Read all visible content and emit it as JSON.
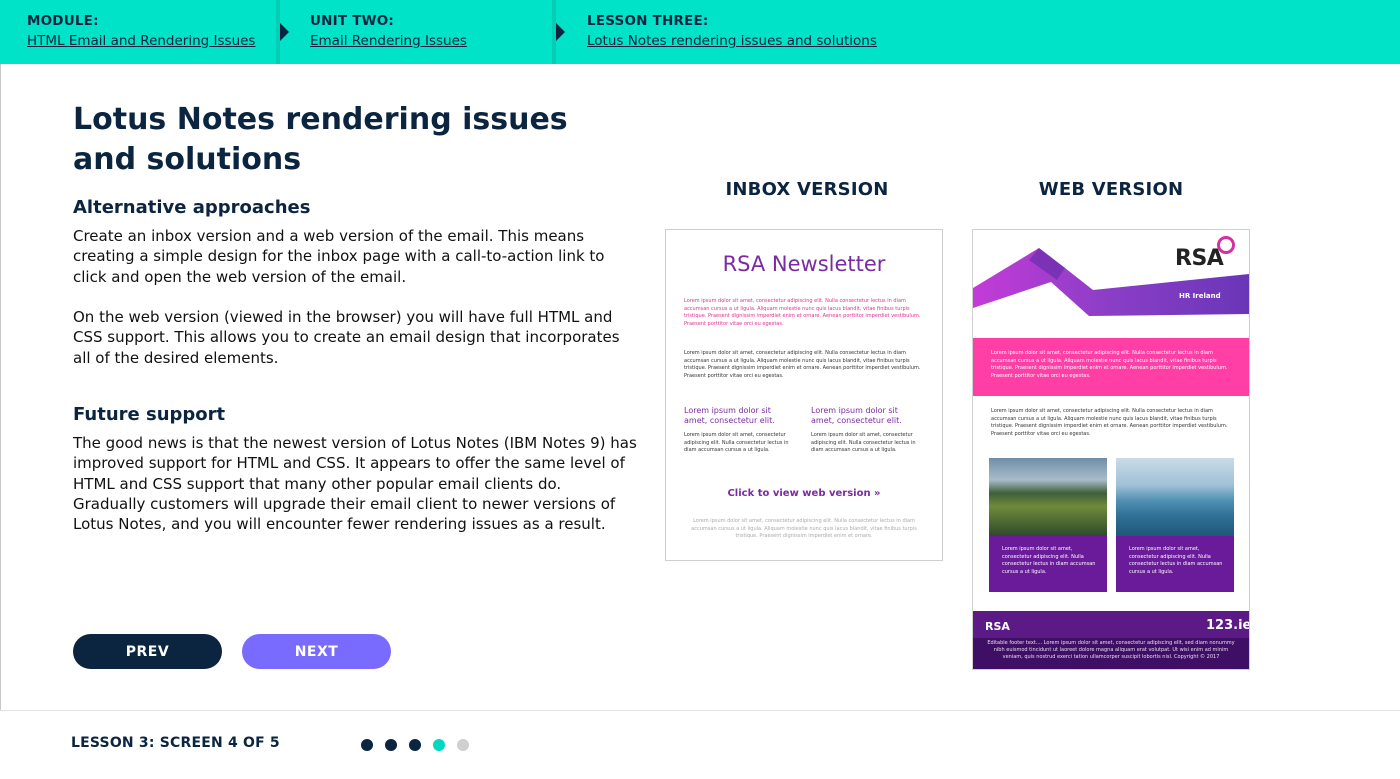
{
  "breadcrumb": {
    "module": {
      "label": "MODULE:",
      "link": "HTML Email and Rendering Issues"
    },
    "unit": {
      "label": "UNIT TWO:",
      "link": "Email Rendering Issues"
    },
    "lesson": {
      "label": "LESSON THREE:",
      "link": "Lotus Notes rendering issues and solutions"
    }
  },
  "content": {
    "title": "Lotus Notes rendering issues and solutions",
    "sections": [
      {
        "heading": "Alternative approaches",
        "paragraphs": [
          "Create an inbox version and a web version of the email. This means creating a simple design for the inbox page with a call-to-action link to click and open the web version of the email.",
          "On the web version (viewed in the browser) you will have full HTML and CSS support. This allows you to create an email design that incorporates all of the desired elements."
        ]
      },
      {
        "heading": "Future support",
        "paragraphs": [
          "The good news is that the newest version of Lotus Notes (IBM Notes 9) has improved support for HTML and CSS. It appears to offer the same level of HTML and CSS support that many other popular email clients do. Gradually customers will upgrade their email client to newer versions of Lotus Notes, and you will encounter fewer rendering issues as a result."
        ]
      }
    ]
  },
  "navigation": {
    "prev": "PREV",
    "next": "NEXT"
  },
  "figure": {
    "inbox_label": "INBOX VERSION",
    "web_label": "WEB VERSION",
    "inbox": {
      "heading": "RSA Newsletter",
      "lorem_pink": "Lorem ipsum dolor sit amet, consectetur adipiscing elit. Nulla consectetur lectus in diam accumsan cursus a ut ligula. Aliquam molestie nunc quis lacus blandit, vitae finibus turpis tristique. Praesent dignissim imperdiet enim et ornare. Aenean porttitor imperdiet vestibulum. Praesent porttitor vitae orci eu egestas.",
      "lorem_body": "Lorem ipsum dolor sit amet, consectetur adipiscing elit. Nulla consectetur lectus in diam accumsan cursus a ut ligula. Aliquam molestie nunc quis lacus blandit, vitae finibus turpis tristique. Praesent dignissim imperdiet enim et ornare. Aenean porttitor imperdiet vestibulum. Praesent porttitor vitae orci eu egestas.",
      "col_heading": "Lorem ipsum dolor sit amet, consectetur elit.",
      "col_text": "Lorem ipsum dolor sit amet, consectetur adipiscing elit. Nulla consectetur lectus in diam accumsan cursus a ut ligula.",
      "cta": "Click to view web version »",
      "lorem_footer": "Lorem ipsum dolor sit amet, consectetur adipiscing elit. Nulla consectetur lectus in diam accumsan cursus a ut ligula. Aliquam molestie nunc quis lacus blandit, vitae finibus turpis tristique. Praesent dignissim imperdiet enim et ornare."
    },
    "web": {
      "logo": "RSA",
      "partner": "HR Ireland",
      "lorem_band": "Lorem ipsum dolor sit amet, consectetur adipiscing elit. Nulla consectetur lectus in diam accumsan cursus a ut ligula. Aliquam molestie nunc quis lacus blandit, vitae finibus turpis tristique. Praesent dignissim imperdiet enim et ornare. Aenean porttitor imperdiet vestibulum. Praesent porttitor vitae orci eu egestas.",
      "lorem_body": "Lorem ipsum dolor sit amet, consectetur adipiscing elit. Nulla consectetur lectus in diam accumsan cursus a ut ligula. Aliquam molestie nunc quis lacus blandit, vitae finibus turpis tristique. Praesent dignissim imperdiet enim et ornare. Aenean porttitor imperdiet vestibulum. Praesent porttitor vitae orci eu egestas.",
      "card_text": "Lorem ipsum dolor sit amet, consectetur adipiscing elit. Nulla consectetur lectus in diam accumsan cursus a ut ligula.",
      "footer_logo": "RSA",
      "footer_brand": "123.ie",
      "footer_text": "Editable footer text.... Lorem ipsum dolor sit amet, consectetur adipiscing elit, sed diam nonummy nibh euismod tincidunt ut laoreet dolore magna aliquam erat volutpat. Ut wisi enim ad minim veniam, quis nostrud exerci tation ullamcorper suscipit lobortis nisl. Copyright © 2017"
    }
  },
  "footer": {
    "status": "LESSON 3: SCREEN 4 OF 5",
    "progress": {
      "current": 4,
      "total": 5
    }
  },
  "colors": {
    "accent": "#00e3c8",
    "navy": "#0b2540",
    "next_button": "#7a6bff",
    "dot_done": "#0b2540",
    "dot_current": "#00d9c0",
    "dot_pending": "#cfcfcf"
  }
}
